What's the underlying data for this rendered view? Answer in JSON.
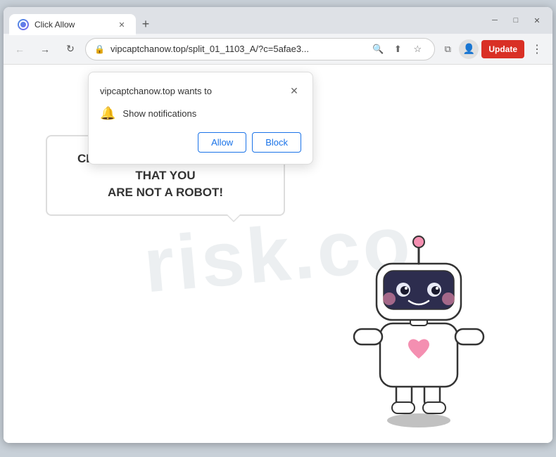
{
  "window": {
    "title": "Click Allow",
    "tab_title": "Click Allow",
    "close_label": "✕",
    "minimize_label": "─",
    "maximize_label": "□",
    "new_tab_label": "+"
  },
  "nav": {
    "back_label": "←",
    "forward_label": "→",
    "reload_label": "↻",
    "url": "vipcaptchanow.top/split_01_1103_A/?c=5afae3...",
    "update_label": "Update",
    "more_label": "⋮"
  },
  "popup": {
    "title": "vipcaptchanow.top wants to",
    "notification_text": "Show notifications",
    "allow_label": "Allow",
    "block_label": "Block",
    "close_label": "✕"
  },
  "speech_bubble": {
    "line1": "CLICK «ALLOW» TO CONFIRM THAT YOU",
    "line2": "ARE NOT A ROBOT!"
  },
  "watermark": {
    "text": "risk.co"
  },
  "icons": {
    "lock": "🔒",
    "search": "🔍",
    "share": "⬆",
    "bookmark": "☆",
    "extensions": "⧉",
    "profile": "👤",
    "bell": "🔔"
  }
}
